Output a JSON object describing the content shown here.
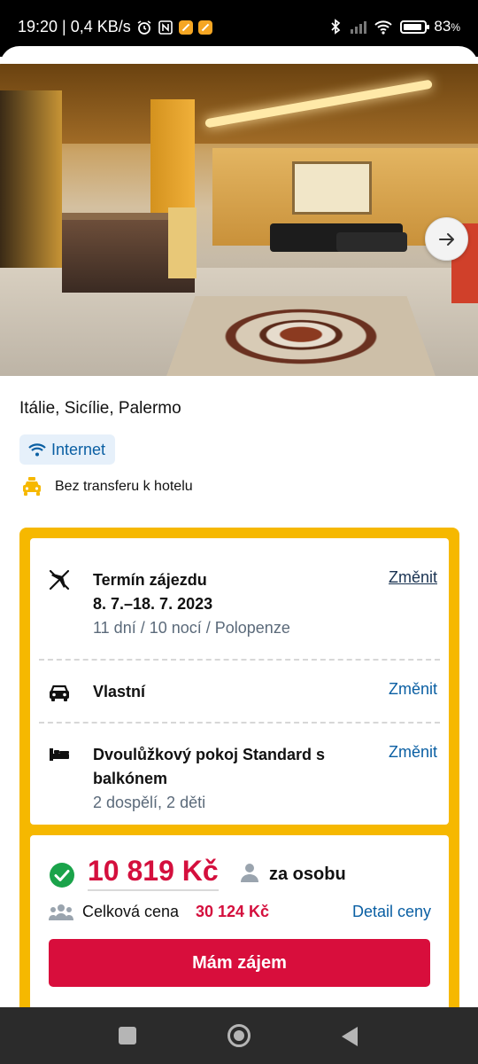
{
  "status_bar": {
    "time_speed": "19:20 | 0,4 KB/s",
    "battery_pct": "83",
    "battery_unit": "%"
  },
  "hotel": {
    "location": "Itálie, Sicílie, Palermo",
    "internet_label": "Internet",
    "transfer_label": "Bez transferu k hotelu"
  },
  "booking": {
    "term": {
      "title": "Termín zájezdu",
      "dates": "8. 7.–18. 7. 2023",
      "details": "11 dní / 10 nocí / Polopenze",
      "change_label": "Změnit"
    },
    "transport": {
      "title": "Vlastní",
      "change_label": "Změnit"
    },
    "room": {
      "title_line1": "Dvoulůžkový pokoj Standard s",
      "title_line2": "balkónem",
      "guests": "2 dospělí, 2 děti",
      "change_label": "Změnit"
    }
  },
  "price": {
    "per_person": "10 819 Kč",
    "per_person_label": "za osobu",
    "total_label": "Celková cena",
    "total_value": "30 124 Kč",
    "detail_link": "Detail ceny",
    "cta_label": "Mám zájem"
  },
  "colors": {
    "accent_yellow": "#f6b800",
    "price_red": "#d40f3d",
    "link_blue": "#0a5fa3",
    "success_green": "#1aa34a"
  }
}
